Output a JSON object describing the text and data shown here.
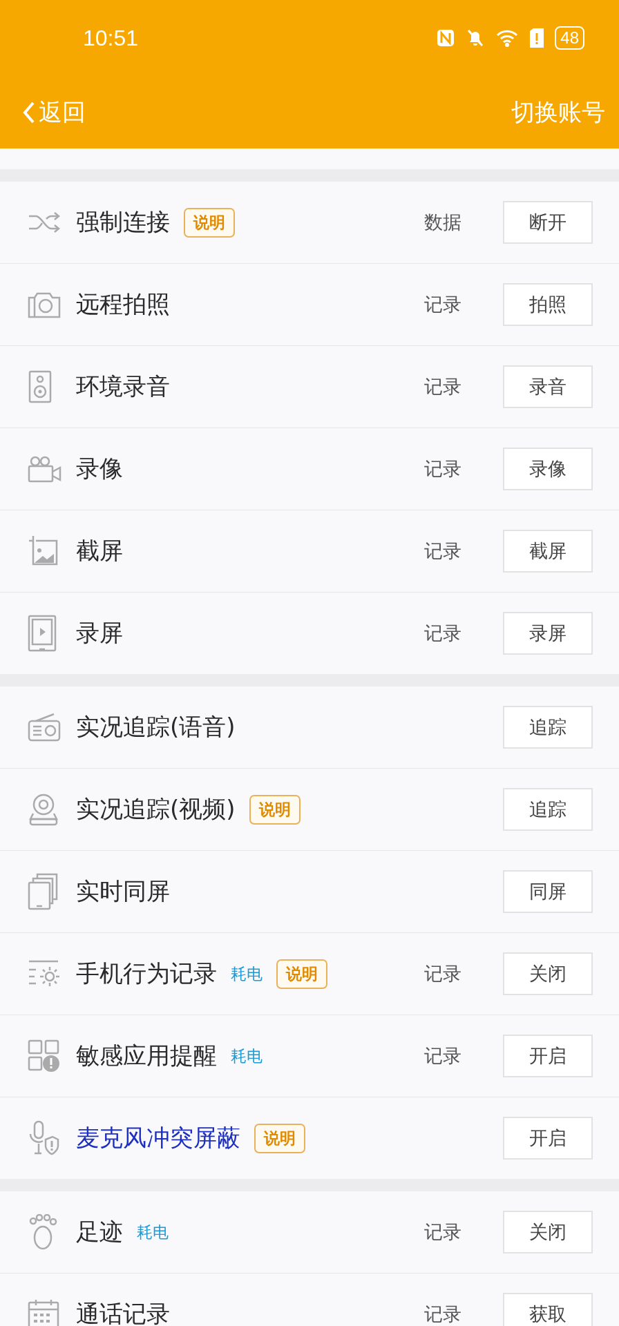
{
  "status_bar": {
    "time": "10:51",
    "battery": "48"
  },
  "nav": {
    "back": "返回",
    "action": "切换账号"
  },
  "sections": [
    {
      "rows": [
        {
          "title": "强制连接",
          "highlighted": false,
          "badges": [
            {
              "kind": "info",
              "text": "说明"
            }
          ],
          "record": "数据",
          "button": "断开"
        },
        {
          "title": "远程拍照",
          "highlighted": false,
          "badges": [],
          "record": "记录",
          "button": "拍照"
        },
        {
          "title": "环境录音",
          "highlighted": false,
          "badges": [],
          "record": "记录",
          "button": "录音"
        },
        {
          "title": "录像",
          "highlighted": false,
          "badges": [],
          "record": "记录",
          "button": "录像"
        },
        {
          "title": "截屏",
          "highlighted": false,
          "badges": [],
          "record": "记录",
          "button": "截屏"
        },
        {
          "title": "录屏",
          "highlighted": false,
          "badges": [],
          "record": "记录",
          "button": "录屏"
        }
      ]
    },
    {
      "rows": [
        {
          "title": "实况追踪(语音)",
          "highlighted": false,
          "badges": [],
          "button": "追踪"
        },
        {
          "title": "实况追踪(视频)",
          "highlighted": false,
          "badges": [
            {
              "kind": "info",
              "text": "说明"
            }
          ],
          "button": "追踪"
        },
        {
          "title": "实时同屏",
          "highlighted": false,
          "badges": [],
          "button": "同屏"
        },
        {
          "title": "手机行为记录",
          "highlighted": false,
          "badges": [
            {
              "kind": "power",
              "text": "耗电"
            },
            {
              "kind": "info",
              "text": "说明"
            }
          ],
          "record": "记录",
          "button": "关闭"
        },
        {
          "title": "敏感应用提醒",
          "highlighted": false,
          "badges": [
            {
              "kind": "power",
              "text": "耗电"
            }
          ],
          "record": "记录",
          "button": "开启"
        },
        {
          "title": "麦克风冲突屏蔽",
          "highlighted": true,
          "badges": [
            {
              "kind": "info",
              "text": "说明"
            }
          ],
          "button": "开启"
        }
      ]
    },
    {
      "rows": [
        {
          "title": "足迹",
          "highlighted": false,
          "badges": [
            {
              "kind": "power",
              "text": "耗电"
            }
          ],
          "record": "记录",
          "button": "关闭"
        },
        {
          "title": "通话记录",
          "highlighted": false,
          "badges": [],
          "record": "记录",
          "button": "获取"
        }
      ]
    }
  ]
}
